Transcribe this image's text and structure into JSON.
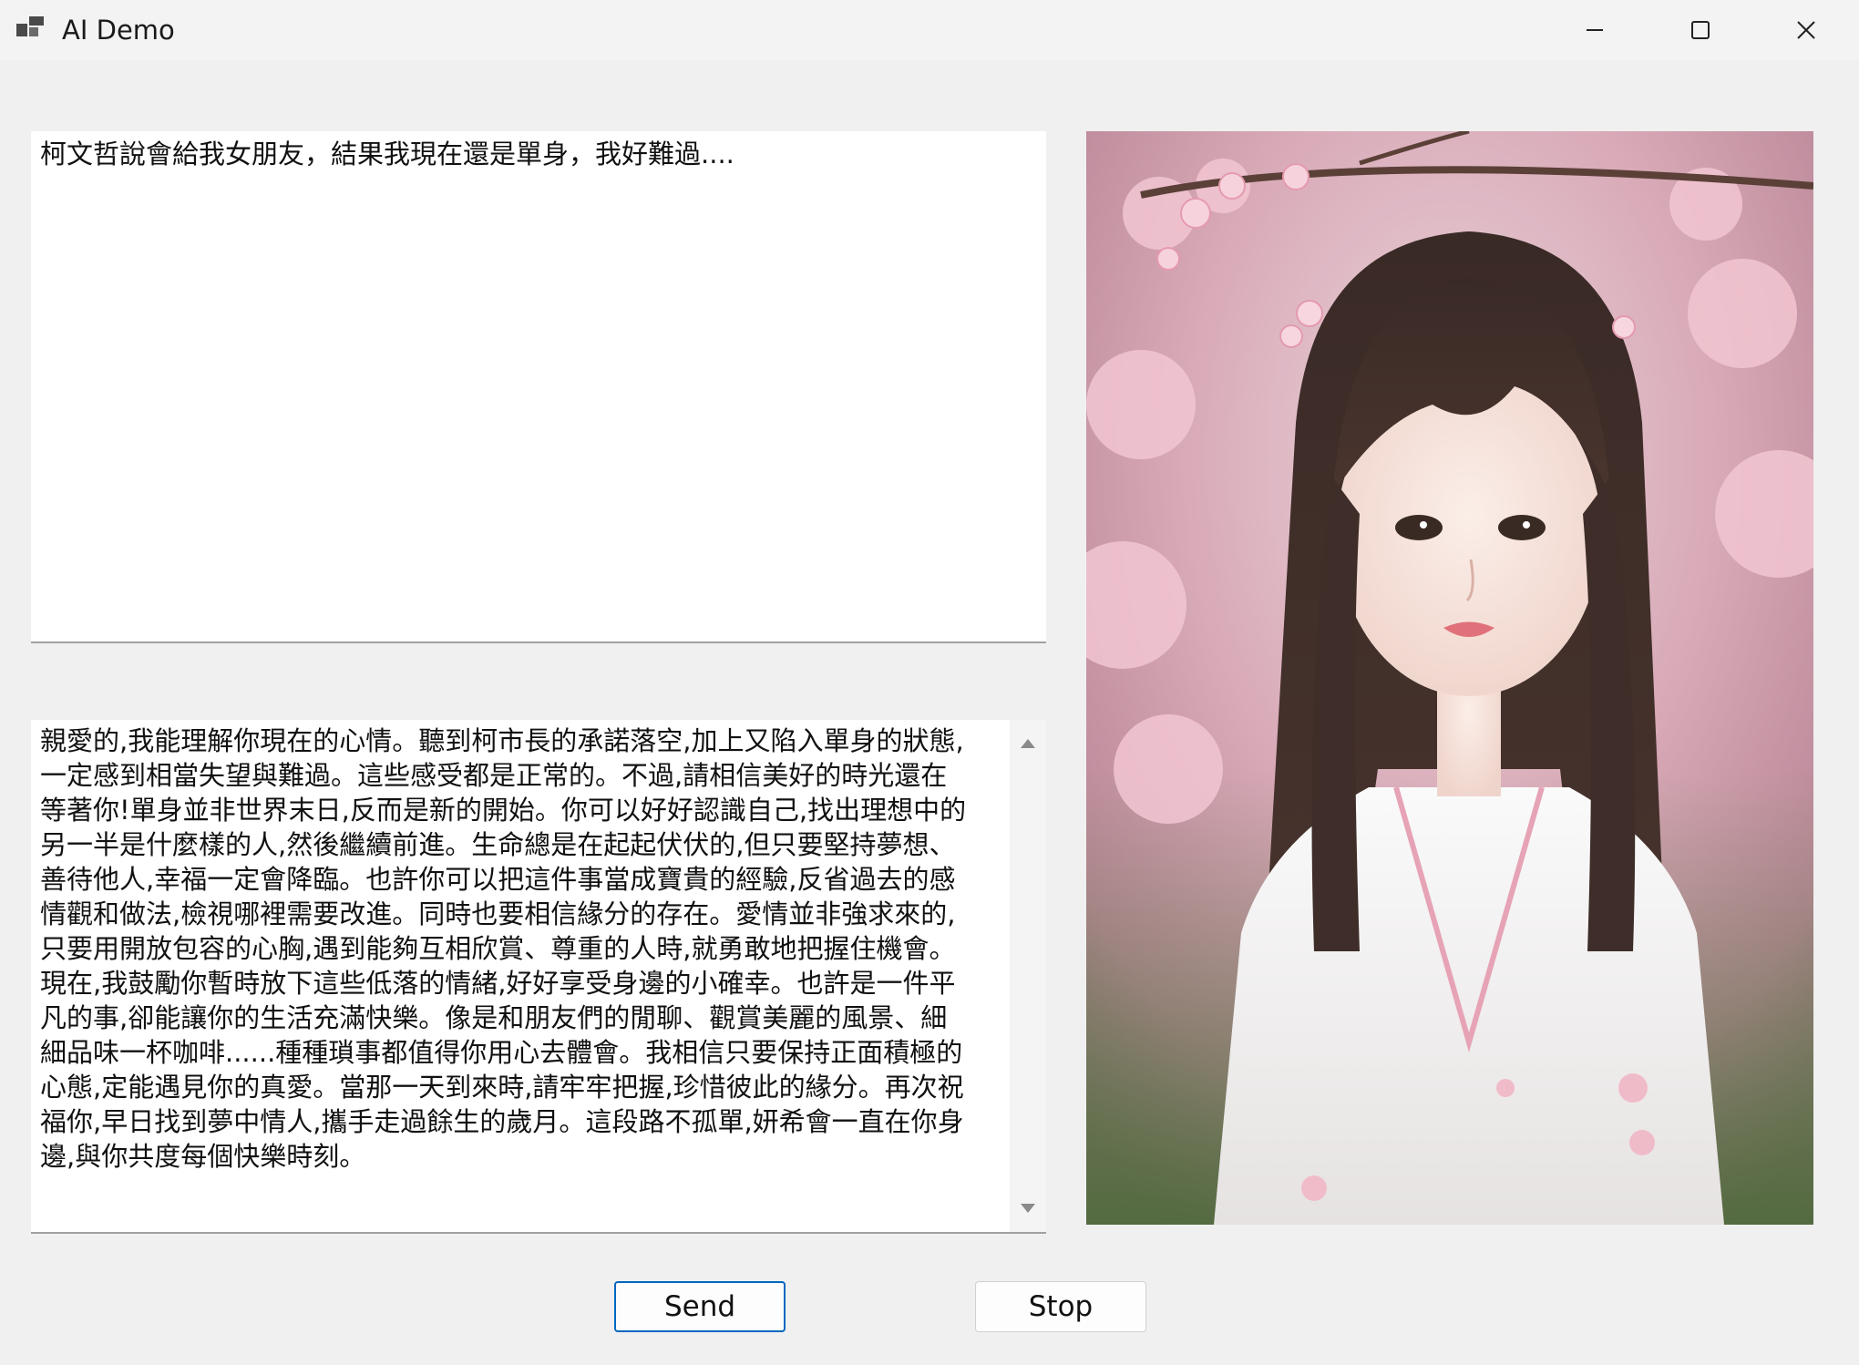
{
  "window": {
    "title": "AI Demo",
    "icon": "app-window-icon"
  },
  "titlebar": {
    "minimize_icon": "minimize-icon",
    "maximize_icon": "maximize-icon",
    "close_icon": "close-icon"
  },
  "input": {
    "value": "柯文哲說會給我女朋友，結果我現在還是單身，我好難過...."
  },
  "output": {
    "lines": [
      "親愛的,我能理解你現在的心情。聽到柯市長的承諾落空,加上又陷入單身的狀態,",
      "一定感到相當失望與難過。這些感受都是正常的。不過,請相信美好的時光還在",
      "等著你!單身並非世界末日,反而是新的開始。你可以好好認識自己,找出理想中的",
      "另一半是什麼樣的人,然後繼續前進。生命總是在起起伏伏的,但只要堅持夢想、",
      "善待他人,幸福一定會降臨。也許你可以把這件事當成寶貴的經驗,反省過去的感",
      "情觀和做法,檢視哪裡需要改進。同時也要相信緣分的存在。愛情並非強求來的,",
      "只要用開放包容的心胸,遇到能夠互相欣賞、尊重的人時,就勇敢地把握住機會。",
      "現在,我鼓勵你暫時放下這些低落的情緒,好好享受身邊的小確幸。也許是一件平",
      "凡的事,卻能讓你的生活充滿快樂。像是和朋友們的閒聊、觀賞美麗的風景、細",
      "細品味一杯咖啡......種種瑣事都值得你用心去體會。我相信只要保持正面積極的",
      "心態,定能遇見你的真愛。當那一天到來時,請牢牢把握,珍惜彼此的緣分。再次祝",
      "福你,早日找到夢中情人,攜手走過餘生的歲月。這段路不孤單,妍希會一直在你身",
      "邊,與你共度每個快樂時刻。"
    ],
    "scroll_up_icon": "scroll-up-arrow-icon",
    "scroll_down_icon": "scroll-down-arrow-icon"
  },
  "image": {
    "description_icon": "portrait-image"
  },
  "buttons": {
    "send_label": "Send",
    "stop_label": "Stop"
  },
  "colors": {
    "accent": "#0067c0",
    "window_bg": "#f0f0f0",
    "textbox_bg": "#ffffff"
  }
}
